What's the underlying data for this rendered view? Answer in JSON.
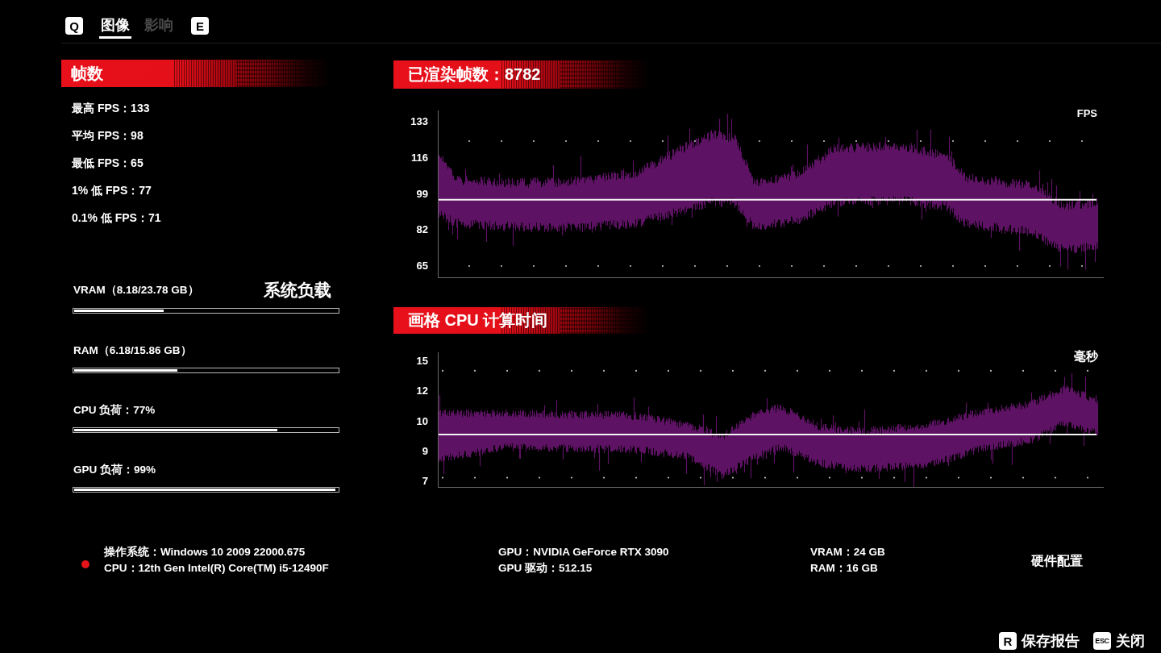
{
  "top_bar": {
    "prev_key": "Q",
    "tabs": [
      {
        "label": "图像",
        "selected": true
      },
      {
        "label": "影响",
        "selected": false
      }
    ],
    "next_key": "E"
  },
  "frame_stats": {
    "title": "帧数",
    "items": [
      "最高 FPS：133",
      "平均 FPS：98",
      "最低 FPS：65",
      "1% 低 FPS：77",
      "0.1% 低 FPS：71"
    ]
  },
  "system_load": {
    "title": "系统负载",
    "meters": [
      {
        "label": "VRAM（8.18/23.78 GB）",
        "level": 0.34
      },
      {
        "label": "RAM（6.18/15.86 GB）",
        "level": 0.39
      },
      {
        "label": "CPU 负荷：77%",
        "level": 0.77
      },
      {
        "label": "GPU 负荷：99%",
        "level": 0.99
      }
    ]
  },
  "frames_chart": {
    "title": "已渲染帧数：8782",
    "unit": "FPS",
    "y_axis_labels": [
      "133",
      "116",
      "99",
      "82",
      "65"
    ]
  },
  "cpu_time_chart": {
    "title": "画格 CPU 计算时间",
    "unit": "毫秒",
    "y_axis_labels": [
      "15",
      "12",
      "10",
      "9",
      "7"
    ]
  },
  "hardware": {
    "columns": [
      [
        "操作系统：Windows 10 2009 22000.675",
        "CPU：12th Gen Intel(R) Core(TM) i5-12490F"
      ],
      [
        "GPU：NVIDIA GeForce RTX 3090",
        "GPU 驱动：512.15"
      ],
      [
        "VRAM：24 GB",
        "RAM：16 GB"
      ]
    ],
    "title": "硬件配置"
  },
  "actions": [
    {
      "key": "R",
      "label": "保存报告"
    },
    {
      "key": "ESC",
      "label": "关闭"
    }
  ]
}
